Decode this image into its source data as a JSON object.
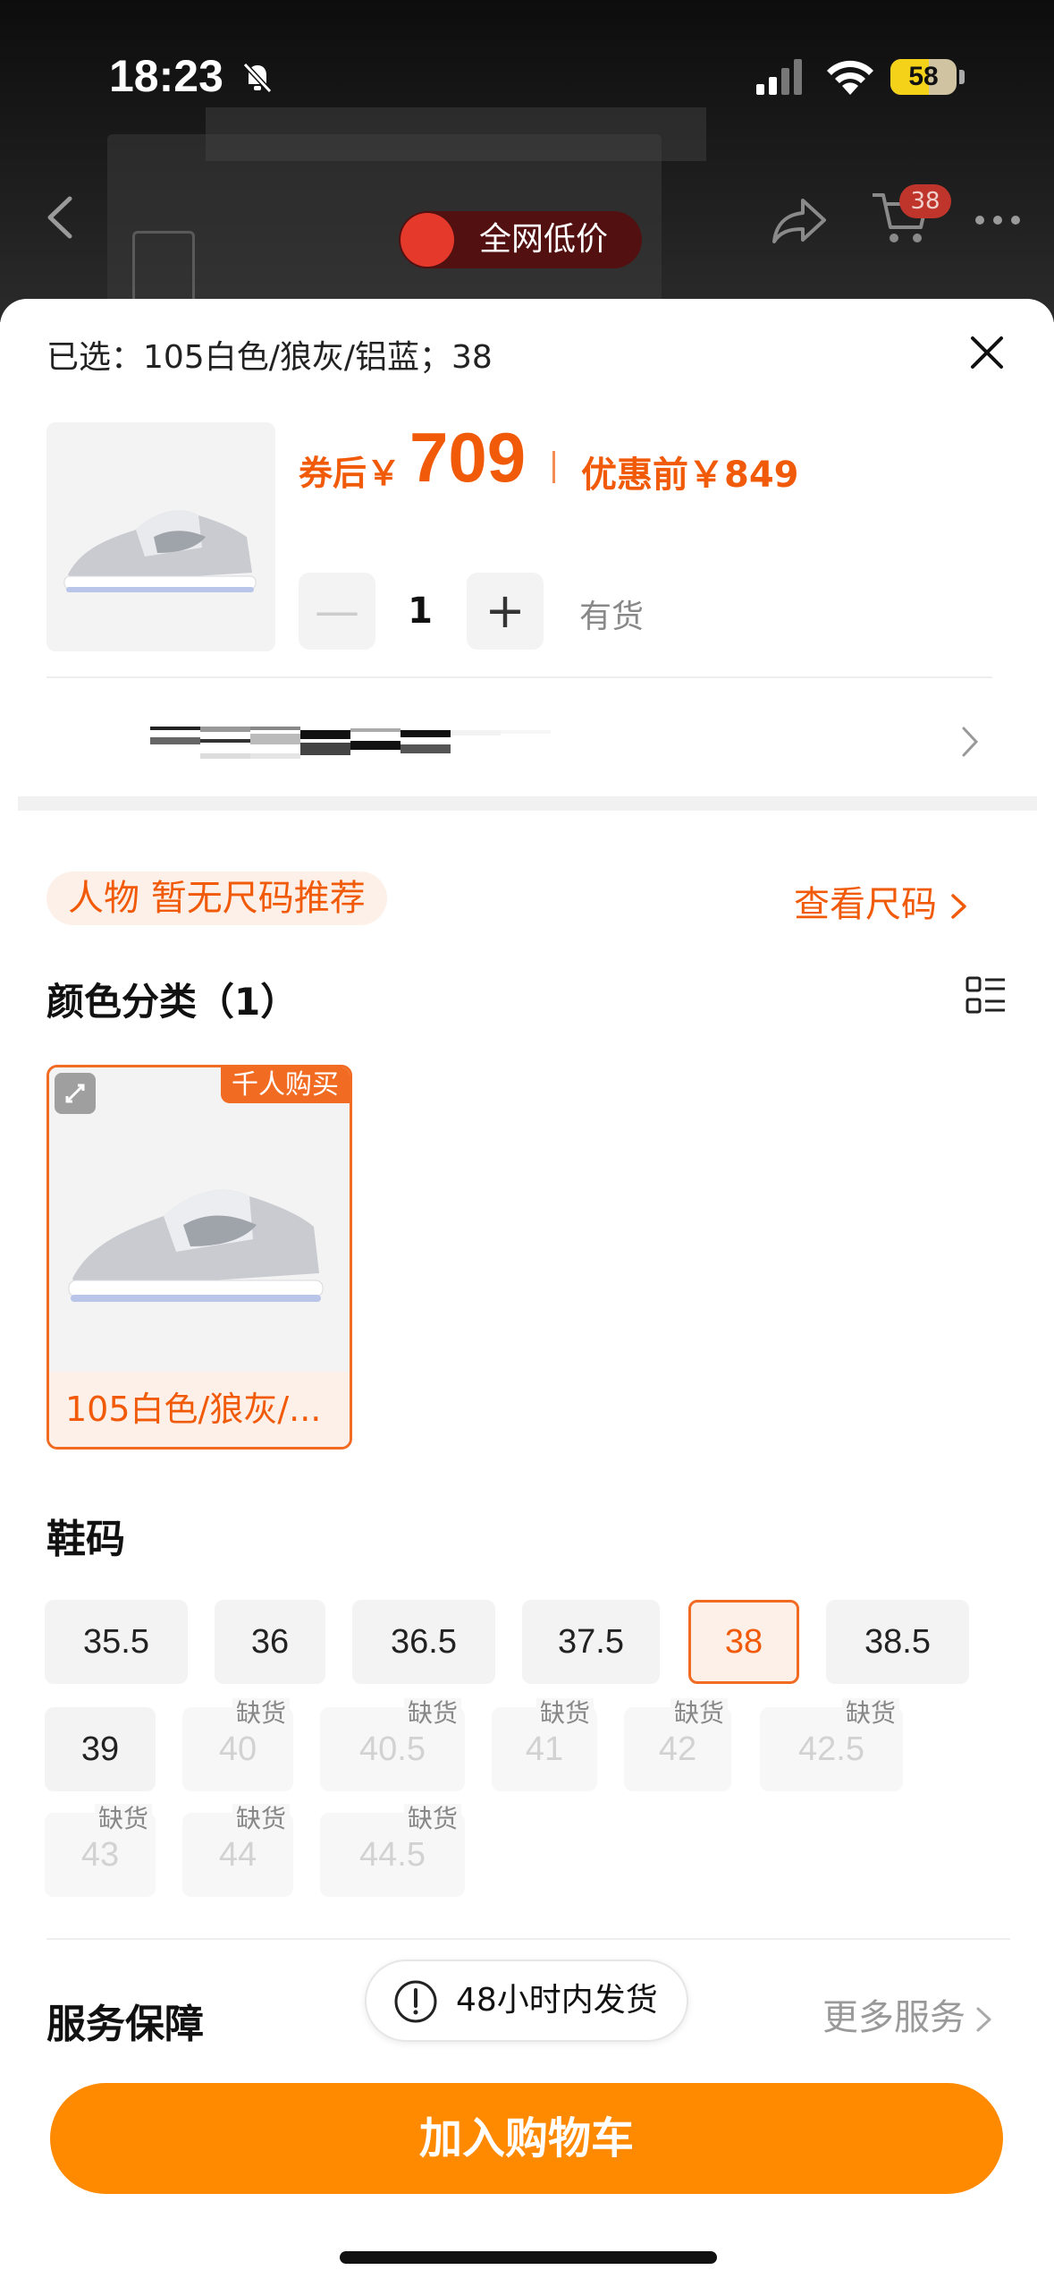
{
  "status_bar": {
    "time": "18:23",
    "battery": "58",
    "battery_level": 0.58
  },
  "top_nav": {
    "cart_count": "38",
    "low_price_label": "全网低价"
  },
  "sheet": {
    "selected_text": "已选：105白色/狼灰/铝蓝；38",
    "price": {
      "after_coupon_label": "券后￥",
      "after_coupon_value": "709",
      "before_label": "优惠前￥849"
    },
    "quantity": {
      "minus": "—",
      "value": "1",
      "plus": "+",
      "stock": "有货"
    },
    "size_recommendation": {
      "text": "人物 暂无尺码推荐",
      "link": "查看尺码"
    },
    "color_section": {
      "title": "颜色分类（1）",
      "items": [
        {
          "label": "105白色/狼灰/...",
          "badge": "千人购买"
        }
      ]
    },
    "size_section": {
      "title": "鞋码",
      "sizes": [
        {
          "label": "35.5",
          "state": "available"
        },
        {
          "label": "36",
          "state": "available"
        },
        {
          "label": "36.5",
          "state": "available"
        },
        {
          "label": "37.5",
          "state": "available"
        },
        {
          "label": "38",
          "state": "selected"
        },
        {
          "label": "38.5",
          "state": "available"
        },
        {
          "label": "39",
          "state": "available"
        },
        {
          "label": "40",
          "state": "out_of_stock",
          "tag": "缺货"
        },
        {
          "label": "40.5",
          "state": "out_of_stock",
          "tag": "缺货"
        },
        {
          "label": "41",
          "state": "out_of_stock",
          "tag": "缺货"
        },
        {
          "label": "42",
          "state": "out_of_stock",
          "tag": "缺货"
        },
        {
          "label": "42.5",
          "state": "out_of_stock",
          "tag": "缺货"
        },
        {
          "label": "43",
          "state": "out_of_stock",
          "tag": "缺货"
        },
        {
          "label": "44",
          "state": "out_of_stock",
          "tag": "缺货"
        },
        {
          "label": "44.5",
          "state": "out_of_stock",
          "tag": "缺货"
        }
      ]
    },
    "service": {
      "title": "服务保障",
      "pill": "48小时内发货",
      "more": "更多服务"
    },
    "add_to_cart": "加入购物车"
  },
  "colors": {
    "accent": "#f05a08",
    "button": "#ff8a00",
    "selected_border": "#f26b22"
  }
}
